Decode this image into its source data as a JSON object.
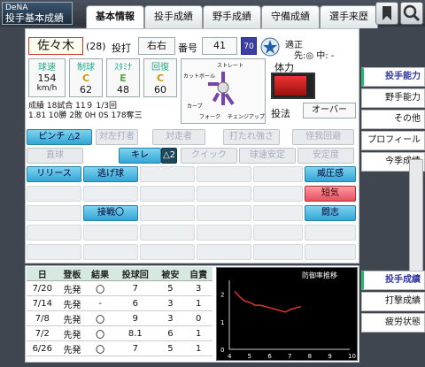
{
  "header": {
    "team": "DeNA",
    "screen_title": "投手基本成績",
    "tabs": [
      "基本情報",
      "投手成績",
      "野手成績",
      "守備成績",
      "選手来歴"
    ],
    "active_tab": "基本情報",
    "icons": [
      "bookmark-icon",
      "search-icon"
    ]
  },
  "player": {
    "name": "佐々木",
    "age": "(28)",
    "throws_label": "投打",
    "throws": "右右",
    "number_label": "番号",
    "number": "41",
    "overall": "70",
    "aptitude_label": "適正",
    "aptitude": "先:◎ 中: -"
  },
  "stats": {
    "labels": [
      "球速",
      "制球",
      "ｽﾀﾐﾅ",
      "回復"
    ],
    "grades": [
      "",
      "C",
      "E",
      "C"
    ],
    "values": [
      "154",
      "62",
      "48",
      "60"
    ],
    "speed_unit": "km/h",
    "record_line1": "成績 18試合 11９ 1/3回",
    "record_line2": "1.81 10勝 2敗 0H 0S 178奪三"
  },
  "pitches": {
    "labels": [
      "ストレート",
      "カットボール",
      "カーブ",
      "フォーク",
      "チェンジアップ"
    ]
  },
  "stamina": {
    "label": "体力",
    "level": 0.85
  },
  "style": {
    "label": "投法",
    "value": "オーバー"
  },
  "abilities": {
    "row1": [
      {
        "label": "ピンチ",
        "rank": "△2",
        "style": "blue"
      },
      {
        "label": "対左打者",
        "style": "grey"
      },
      {
        "label": "対走者",
        "style": "grey"
      },
      {
        "label": "打たれ強さ",
        "style": "grey"
      },
      {
        "label": "怪我回避",
        "style": "grey"
      }
    ],
    "row2": [
      {
        "label": "直球",
        "style": "grey"
      },
      {
        "label": "キレ",
        "rank": "△2",
        "style": "blue"
      },
      {
        "label": "クイック",
        "style": "grey"
      },
      {
        "label": "球速安定",
        "style": "grey"
      },
      {
        "label": "安定度",
        "style": "grey"
      }
    ],
    "special": [
      {
        "label": "リリース",
        "style": "blue"
      },
      {
        "label": "逃げ球",
        "style": "blue"
      },
      {
        "label": "威圧感",
        "style": "blue"
      },
      {
        "label": "短気",
        "style": "red"
      },
      {
        "label": "闘志",
        "style": "blue"
      },
      {
        "label": "接戦〇",
        "style": "blue"
      }
    ]
  },
  "log": {
    "headers": [
      "日",
      "登板",
      "結果",
      "投球回",
      "被安",
      "自責"
    ],
    "rows": [
      [
        "7/20",
        "先発",
        "〇",
        "7",
        "5",
        "3"
      ],
      [
        "7/14",
        "先発",
        "-",
        "6",
        "3",
        "1"
      ],
      [
        "7/8",
        "先発",
        "〇",
        "9",
        "3",
        "0"
      ],
      [
        "7/2",
        "先発",
        "〇",
        "8.1",
        "6",
        "1"
      ],
      [
        "6/26",
        "先発",
        "〇",
        "7",
        "5",
        "1"
      ]
    ]
  },
  "chart_data": {
    "type": "line",
    "title": "防御率推移",
    "x_ticks": [
      "4",
      "5",
      "6",
      "7",
      "8",
      "9",
      "10"
    ],
    "y_ticks": [
      "0",
      "1",
      "2"
    ],
    "ylim": [
      0,
      2.5
    ],
    "series": [
      {
        "values": [
          2.1,
          1.9,
          1.75,
          1.7,
          1.6,
          1.6,
          1.55,
          1.5,
          1.45,
          1.4,
          1.35,
          1.45,
          1.5,
          1.55
        ]
      }
    ]
  },
  "right_menu": {
    "top": [
      "投手能力",
      "野手能力",
      "その他",
      "プロフィール",
      "今季成績"
    ],
    "bottom": [
      "投手成績",
      "打撃成績",
      "疲労状態"
    ],
    "selected_top": "投手能力",
    "selected_bottom": "投手成績"
  },
  "colors": {
    "accent": "#33a5d6",
    "bad": "#e4515e",
    "header": "#2e343b"
  }
}
